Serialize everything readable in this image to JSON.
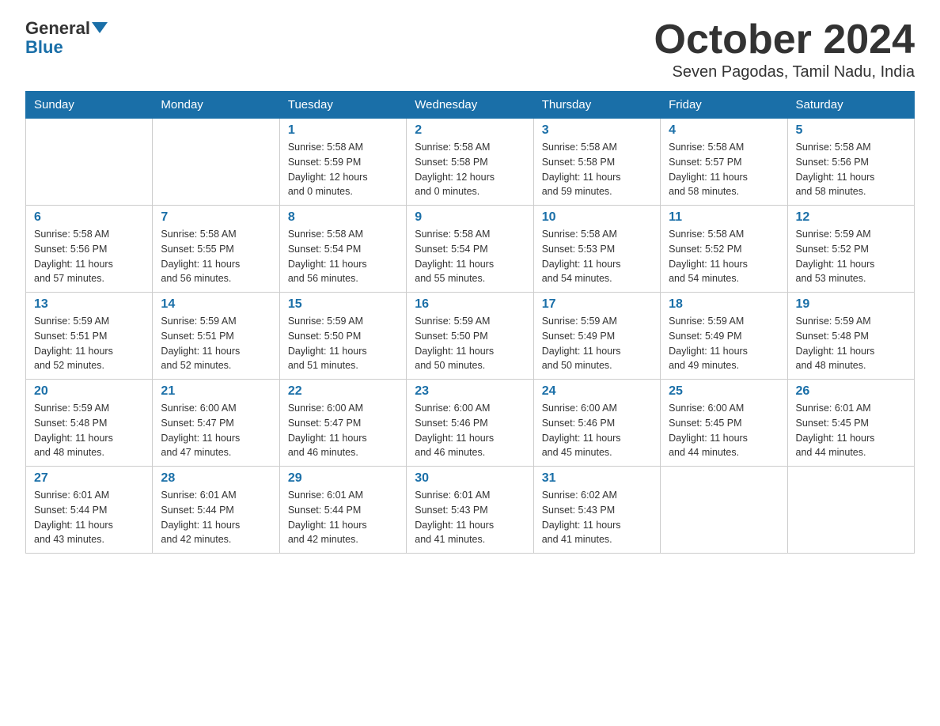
{
  "header": {
    "logo_general": "General",
    "logo_blue": "Blue",
    "month_title": "October 2024",
    "location": "Seven Pagodas, Tamil Nadu, India"
  },
  "weekdays": [
    "Sunday",
    "Monday",
    "Tuesday",
    "Wednesday",
    "Thursday",
    "Friday",
    "Saturday"
  ],
  "weeks": [
    [
      {
        "day": "",
        "info": ""
      },
      {
        "day": "",
        "info": ""
      },
      {
        "day": "1",
        "info": "Sunrise: 5:58 AM\nSunset: 5:59 PM\nDaylight: 12 hours\nand 0 minutes."
      },
      {
        "day": "2",
        "info": "Sunrise: 5:58 AM\nSunset: 5:58 PM\nDaylight: 12 hours\nand 0 minutes."
      },
      {
        "day": "3",
        "info": "Sunrise: 5:58 AM\nSunset: 5:58 PM\nDaylight: 11 hours\nand 59 minutes."
      },
      {
        "day": "4",
        "info": "Sunrise: 5:58 AM\nSunset: 5:57 PM\nDaylight: 11 hours\nand 58 minutes."
      },
      {
        "day": "5",
        "info": "Sunrise: 5:58 AM\nSunset: 5:56 PM\nDaylight: 11 hours\nand 58 minutes."
      }
    ],
    [
      {
        "day": "6",
        "info": "Sunrise: 5:58 AM\nSunset: 5:56 PM\nDaylight: 11 hours\nand 57 minutes."
      },
      {
        "day": "7",
        "info": "Sunrise: 5:58 AM\nSunset: 5:55 PM\nDaylight: 11 hours\nand 56 minutes."
      },
      {
        "day": "8",
        "info": "Sunrise: 5:58 AM\nSunset: 5:54 PM\nDaylight: 11 hours\nand 56 minutes."
      },
      {
        "day": "9",
        "info": "Sunrise: 5:58 AM\nSunset: 5:54 PM\nDaylight: 11 hours\nand 55 minutes."
      },
      {
        "day": "10",
        "info": "Sunrise: 5:58 AM\nSunset: 5:53 PM\nDaylight: 11 hours\nand 54 minutes."
      },
      {
        "day": "11",
        "info": "Sunrise: 5:58 AM\nSunset: 5:52 PM\nDaylight: 11 hours\nand 54 minutes."
      },
      {
        "day": "12",
        "info": "Sunrise: 5:59 AM\nSunset: 5:52 PM\nDaylight: 11 hours\nand 53 minutes."
      }
    ],
    [
      {
        "day": "13",
        "info": "Sunrise: 5:59 AM\nSunset: 5:51 PM\nDaylight: 11 hours\nand 52 minutes."
      },
      {
        "day": "14",
        "info": "Sunrise: 5:59 AM\nSunset: 5:51 PM\nDaylight: 11 hours\nand 52 minutes."
      },
      {
        "day": "15",
        "info": "Sunrise: 5:59 AM\nSunset: 5:50 PM\nDaylight: 11 hours\nand 51 minutes."
      },
      {
        "day": "16",
        "info": "Sunrise: 5:59 AM\nSunset: 5:50 PM\nDaylight: 11 hours\nand 50 minutes."
      },
      {
        "day": "17",
        "info": "Sunrise: 5:59 AM\nSunset: 5:49 PM\nDaylight: 11 hours\nand 50 minutes."
      },
      {
        "day": "18",
        "info": "Sunrise: 5:59 AM\nSunset: 5:49 PM\nDaylight: 11 hours\nand 49 minutes."
      },
      {
        "day": "19",
        "info": "Sunrise: 5:59 AM\nSunset: 5:48 PM\nDaylight: 11 hours\nand 48 minutes."
      }
    ],
    [
      {
        "day": "20",
        "info": "Sunrise: 5:59 AM\nSunset: 5:48 PM\nDaylight: 11 hours\nand 48 minutes."
      },
      {
        "day": "21",
        "info": "Sunrise: 6:00 AM\nSunset: 5:47 PM\nDaylight: 11 hours\nand 47 minutes."
      },
      {
        "day": "22",
        "info": "Sunrise: 6:00 AM\nSunset: 5:47 PM\nDaylight: 11 hours\nand 46 minutes."
      },
      {
        "day": "23",
        "info": "Sunrise: 6:00 AM\nSunset: 5:46 PM\nDaylight: 11 hours\nand 46 minutes."
      },
      {
        "day": "24",
        "info": "Sunrise: 6:00 AM\nSunset: 5:46 PM\nDaylight: 11 hours\nand 45 minutes."
      },
      {
        "day": "25",
        "info": "Sunrise: 6:00 AM\nSunset: 5:45 PM\nDaylight: 11 hours\nand 44 minutes."
      },
      {
        "day": "26",
        "info": "Sunrise: 6:01 AM\nSunset: 5:45 PM\nDaylight: 11 hours\nand 44 minutes."
      }
    ],
    [
      {
        "day": "27",
        "info": "Sunrise: 6:01 AM\nSunset: 5:44 PM\nDaylight: 11 hours\nand 43 minutes."
      },
      {
        "day": "28",
        "info": "Sunrise: 6:01 AM\nSunset: 5:44 PM\nDaylight: 11 hours\nand 42 minutes."
      },
      {
        "day": "29",
        "info": "Sunrise: 6:01 AM\nSunset: 5:44 PM\nDaylight: 11 hours\nand 42 minutes."
      },
      {
        "day": "30",
        "info": "Sunrise: 6:01 AM\nSunset: 5:43 PM\nDaylight: 11 hours\nand 41 minutes."
      },
      {
        "day": "31",
        "info": "Sunrise: 6:02 AM\nSunset: 5:43 PM\nDaylight: 11 hours\nand 41 minutes."
      },
      {
        "day": "",
        "info": ""
      },
      {
        "day": "",
        "info": ""
      }
    ]
  ]
}
